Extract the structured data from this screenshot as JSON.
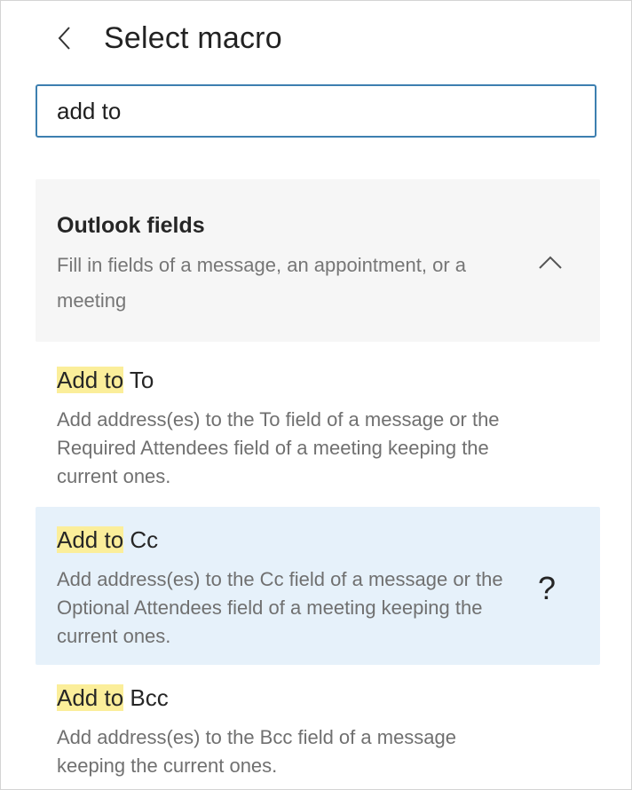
{
  "header": {
    "title": "Select macro"
  },
  "search": {
    "value": "add to"
  },
  "group": {
    "title": "Outlook fields",
    "description": "Fill in fields of a message, an appointment, or a meeting"
  },
  "items": [
    {
      "highlight": "Add to",
      "rest": " To",
      "description": "Add address(es) to the To field of a message or the Required Attendees field of a meeting keeping the current ones."
    },
    {
      "highlight": "Add to",
      "rest": " Cc",
      "description": "Add address(es) to the Cc field of a message or the Optional Attendees field of a meeting keeping the current ones.",
      "help_glyph": "?"
    },
    {
      "highlight": "Add to",
      "rest": " Bcc",
      "description": "Add address(es) to the Bcc field of a message keeping the current ones."
    }
  ],
  "colors": {
    "search_border": "#3d7fb0",
    "highlight": "#fbee9a",
    "hover_row": "#e6f1fa",
    "group_bg": "#f6f6f6"
  },
  "icons": {
    "back": "chevron-left-icon",
    "collapse": "chevron-up-icon",
    "help": "question-mark-icon"
  }
}
